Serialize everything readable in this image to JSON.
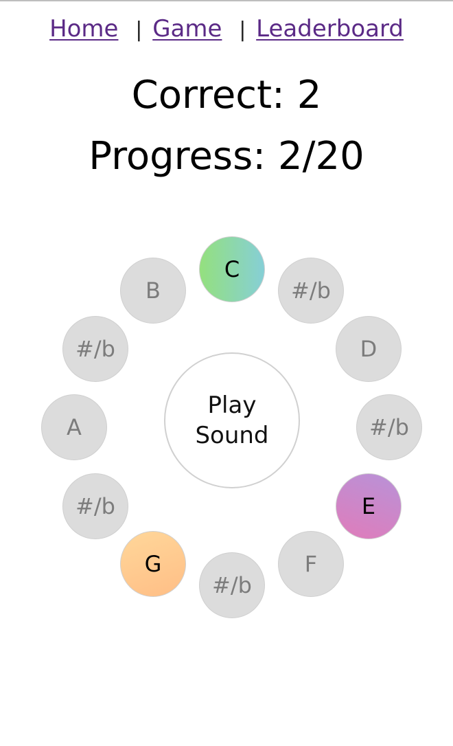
{
  "nav": {
    "home": "Home",
    "game": "Game",
    "leaderboard": "Leaderboard",
    "separator": "|"
  },
  "stats": {
    "correct_text": "Correct: 2",
    "progress_text": "Progress: 2/20"
  },
  "wheel": {
    "play_label": "Play Sound",
    "notes": [
      {
        "label": "C",
        "state": "highlighted",
        "color": "#8fd8a8"
      },
      {
        "label": "#/b",
        "state": "inactive"
      },
      {
        "label": "D",
        "state": "inactive"
      },
      {
        "label": "#/b",
        "state": "inactive"
      },
      {
        "label": "E",
        "state": "highlighted",
        "color": "#cc86c8"
      },
      {
        "label": "F",
        "state": "inactive"
      },
      {
        "label": "#/b",
        "state": "inactive"
      },
      {
        "label": "G",
        "state": "highlighted",
        "color": "#ffc98f"
      },
      {
        "label": "#/b",
        "state": "inactive"
      },
      {
        "label": "A",
        "state": "inactive"
      },
      {
        "label": "#/b",
        "state": "inactive"
      },
      {
        "label": "B",
        "state": "inactive"
      }
    ]
  },
  "colors": {
    "link": "#5b2a86",
    "inactive_note": "#dcdcdc",
    "inactive_text": "#7c7c7c"
  }
}
